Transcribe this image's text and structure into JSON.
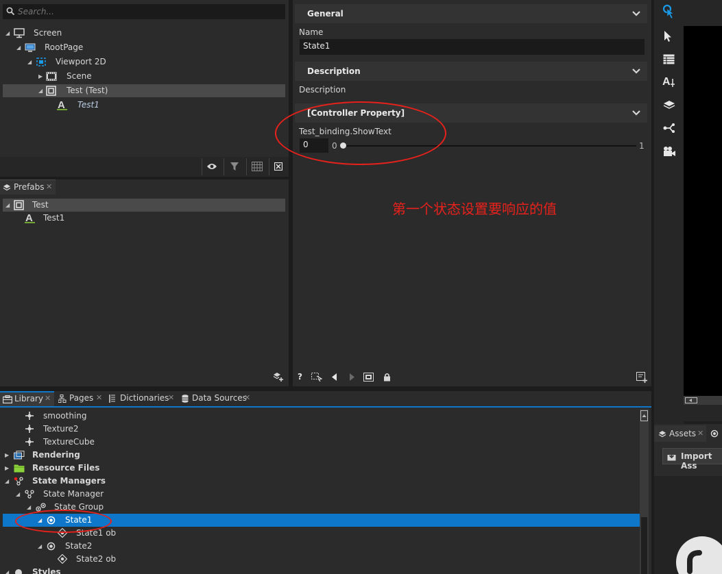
{
  "hierarchy": {
    "search_placeholder": "Search...",
    "nodes": [
      {
        "label": "Screen"
      },
      {
        "label": "RootPage"
      },
      {
        "label": "Viewport 2D"
      },
      {
        "label": "Scene"
      },
      {
        "label": "Test (Test)"
      },
      {
        "label": "Test1"
      }
    ]
  },
  "prefabs": {
    "tab_label": "Prefabs",
    "nodes": [
      {
        "label": "Test"
      },
      {
        "label": "Test1"
      }
    ]
  },
  "properties": {
    "general": {
      "header": "General",
      "name_label": "Name",
      "name_value": "State1"
    },
    "description": {
      "header": "Description",
      "label": "Description"
    },
    "controller": {
      "header": "[Controller Property]",
      "binding_label": "Test_binding.ShowText",
      "value": "0",
      "slider_min": "0",
      "slider_max": "1",
      "slider_fraction": 0.0
    },
    "annotation": "第一个状态设置要响应的值"
  },
  "library": {
    "tabs": [
      {
        "label": "Library"
      },
      {
        "label": "Pages"
      },
      {
        "label": "Dictionaries"
      },
      {
        "label": "Data Sources"
      }
    ],
    "rows": [
      {
        "label": "smoothing"
      },
      {
        "label": "Texture2"
      },
      {
        "label": "TextureCube"
      },
      {
        "label": "Rendering"
      },
      {
        "label": "Resource Files"
      },
      {
        "label": "State Managers"
      },
      {
        "label": "State Manager"
      },
      {
        "label": "State Group"
      },
      {
        "label": "State1"
      },
      {
        "label": "State1 ob"
      },
      {
        "label": "State2"
      },
      {
        "label": "State2 ob"
      },
      {
        "label": "Styles"
      }
    ]
  },
  "assets": {
    "tab_label": "Assets",
    "import_label": "Import Ass"
  },
  "colors": {
    "selection": "#0e77c9",
    "annotation": "#e8211b",
    "accent_icon": "#1a9be8"
  }
}
